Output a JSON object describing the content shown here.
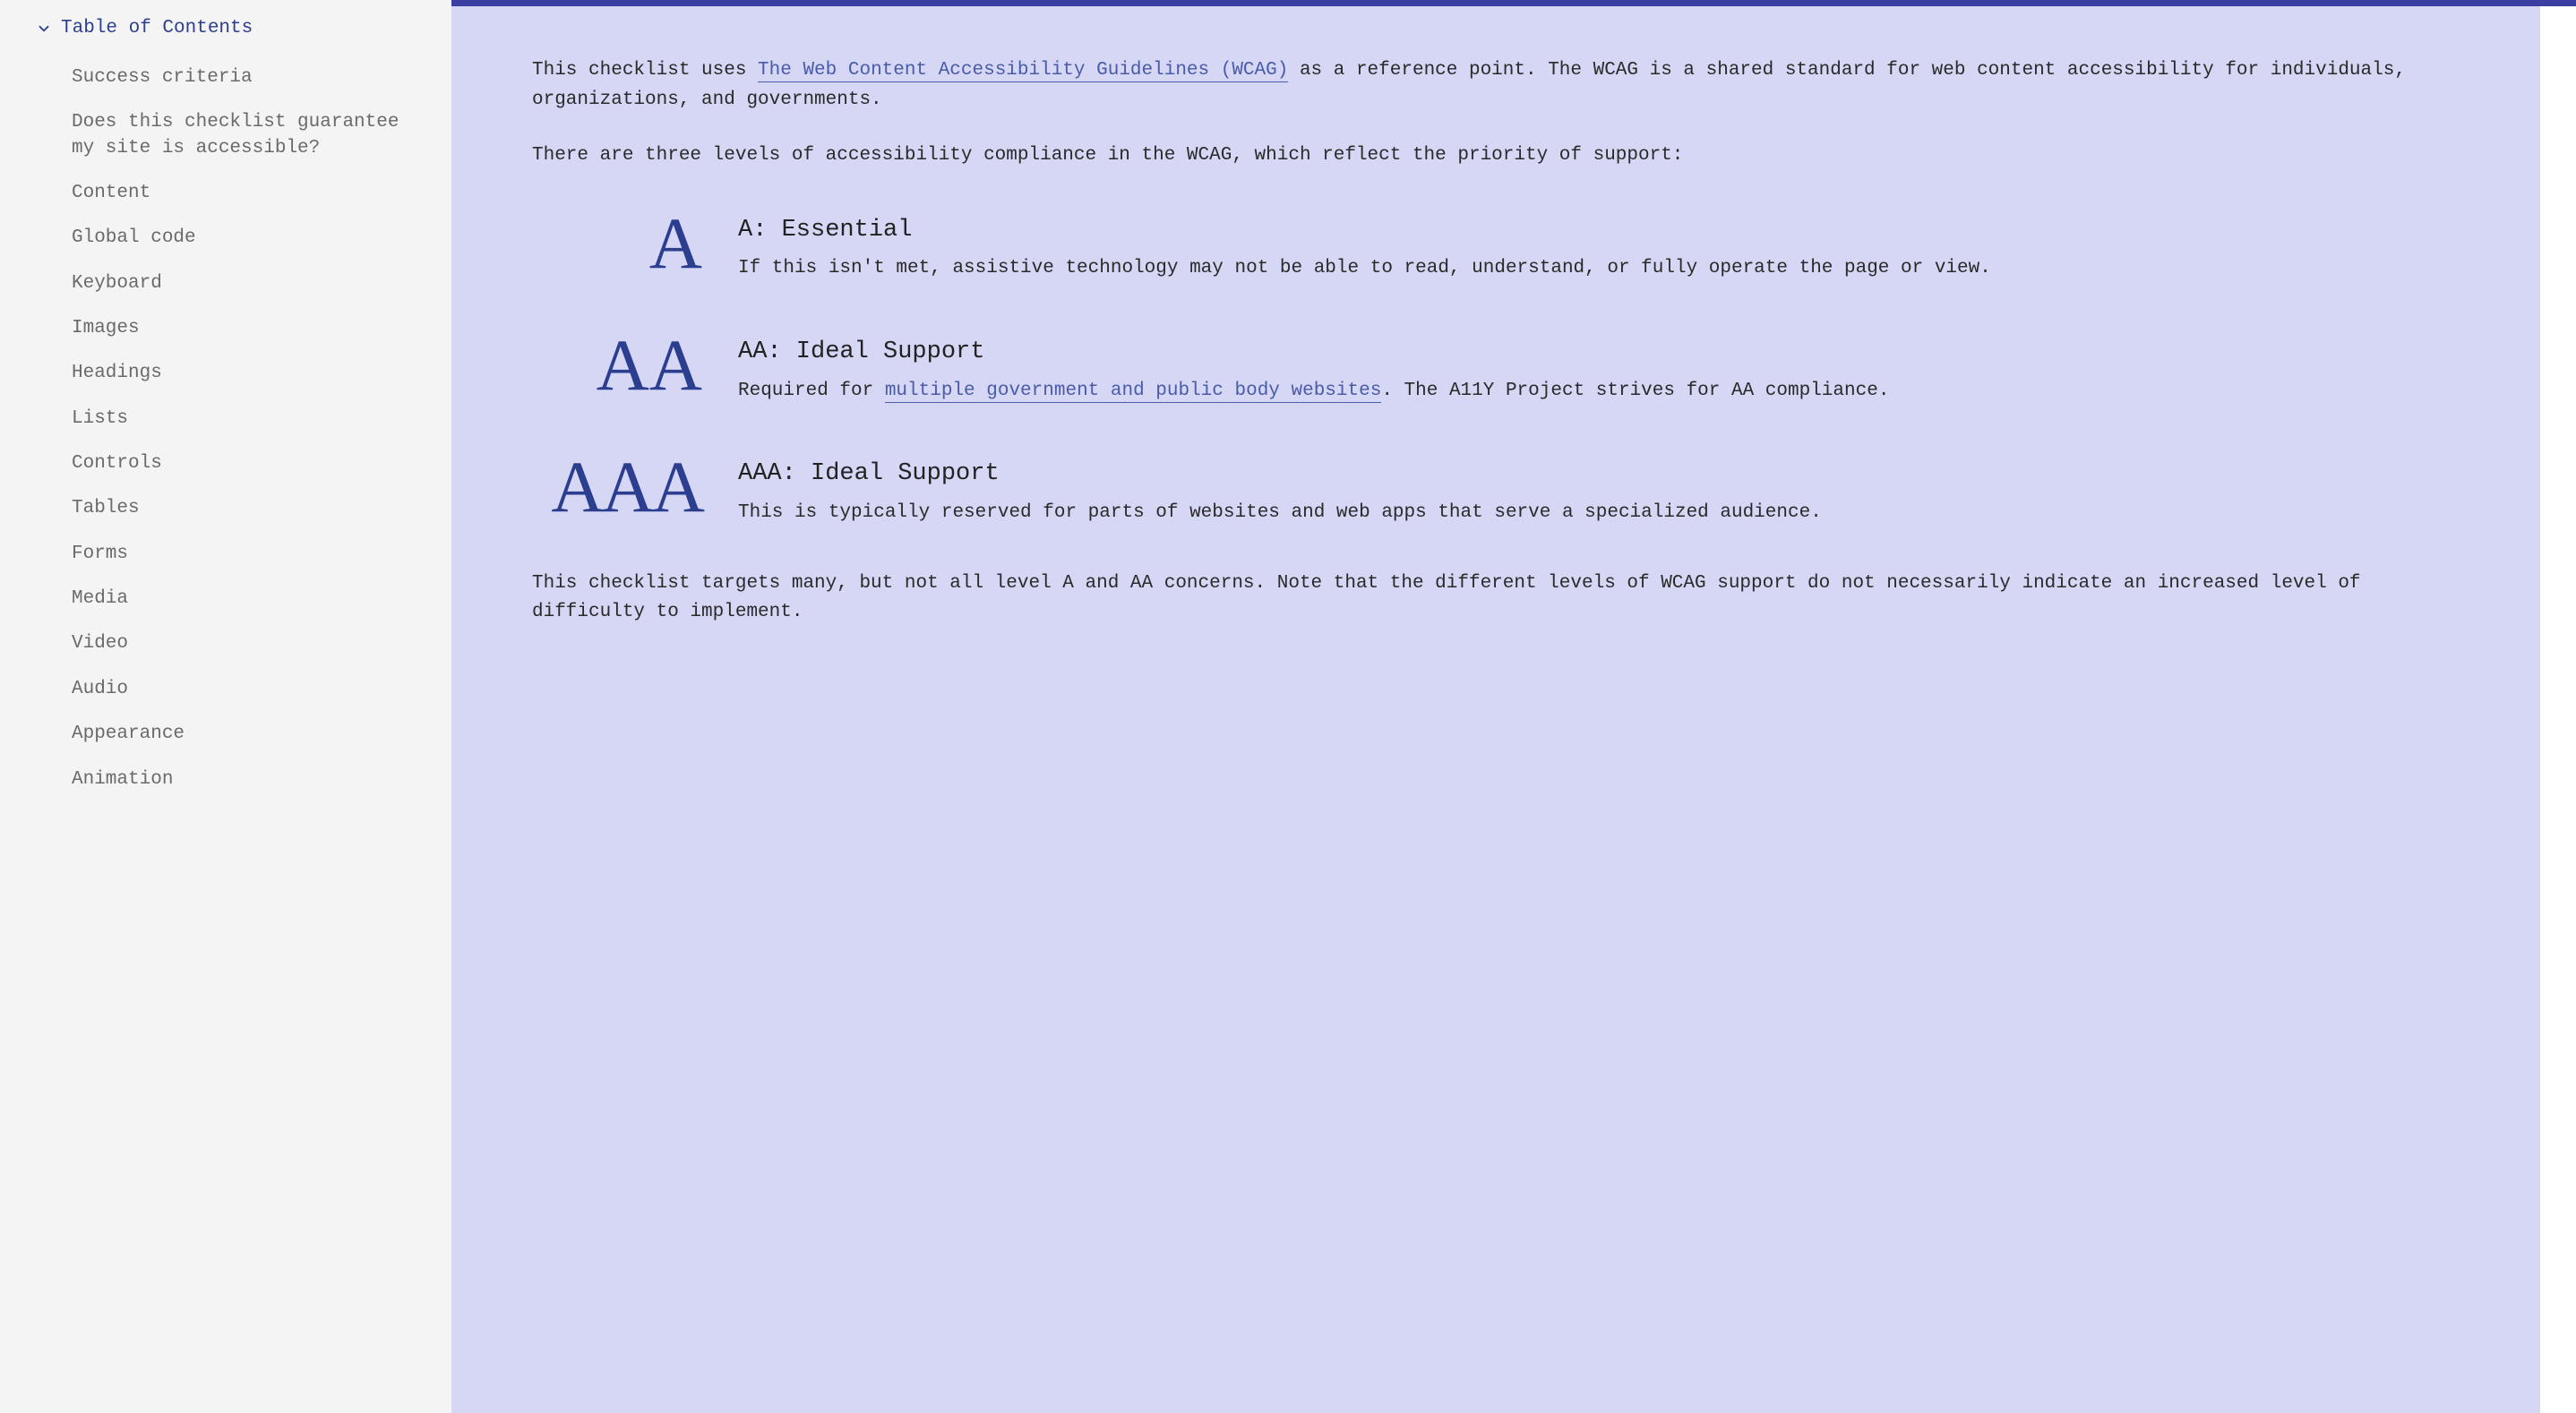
{
  "sidebar": {
    "title": "Table of Contents",
    "items": [
      "Success criteria",
      "Does this checklist guarantee my site is accessible?",
      "Content",
      "Global code",
      "Keyboard",
      "Images",
      "Headings",
      "Lists",
      "Controls",
      "Tables",
      "Forms",
      "Media",
      "Video",
      "Audio",
      "Appearance",
      "Animation"
    ]
  },
  "intro": {
    "p1_pre": "This checklist uses ",
    "p1_link": "The Web Content Accessibility Guidelines (WCAG)",
    "p1_post": " as a reference point. The WCAG is a shared standard for web content accessibility for individuals, organizations, and governments.",
    "p2": "There are three levels of accessibility compliance in the WCAG, which reflect the priority of support:"
  },
  "levels": [
    {
      "badge": "A",
      "title": "A: Essential",
      "desc_pre": "If this isn't met, assistive technology may not be able to read, understand, or fully operate the page or view.",
      "link": "",
      "desc_post": ""
    },
    {
      "badge": "AA",
      "title": "AA: Ideal Support",
      "desc_pre": "Required for ",
      "link": "multiple government and public body websites",
      "desc_post": ". The A11Y Project strives for AA compliance."
    },
    {
      "badge": "AAA",
      "title": "AAA: Ideal Support",
      "desc_pre": "This is typically reserved for parts of websites and web apps that serve a specialized audience.",
      "link": "",
      "desc_post": ""
    }
  ],
  "outro": {
    "p1": "This checklist targets many, but not all level A and AA concerns. Note that the different levels of WCAG support do not necessarily indicate an increased level of difficulty to implement."
  }
}
